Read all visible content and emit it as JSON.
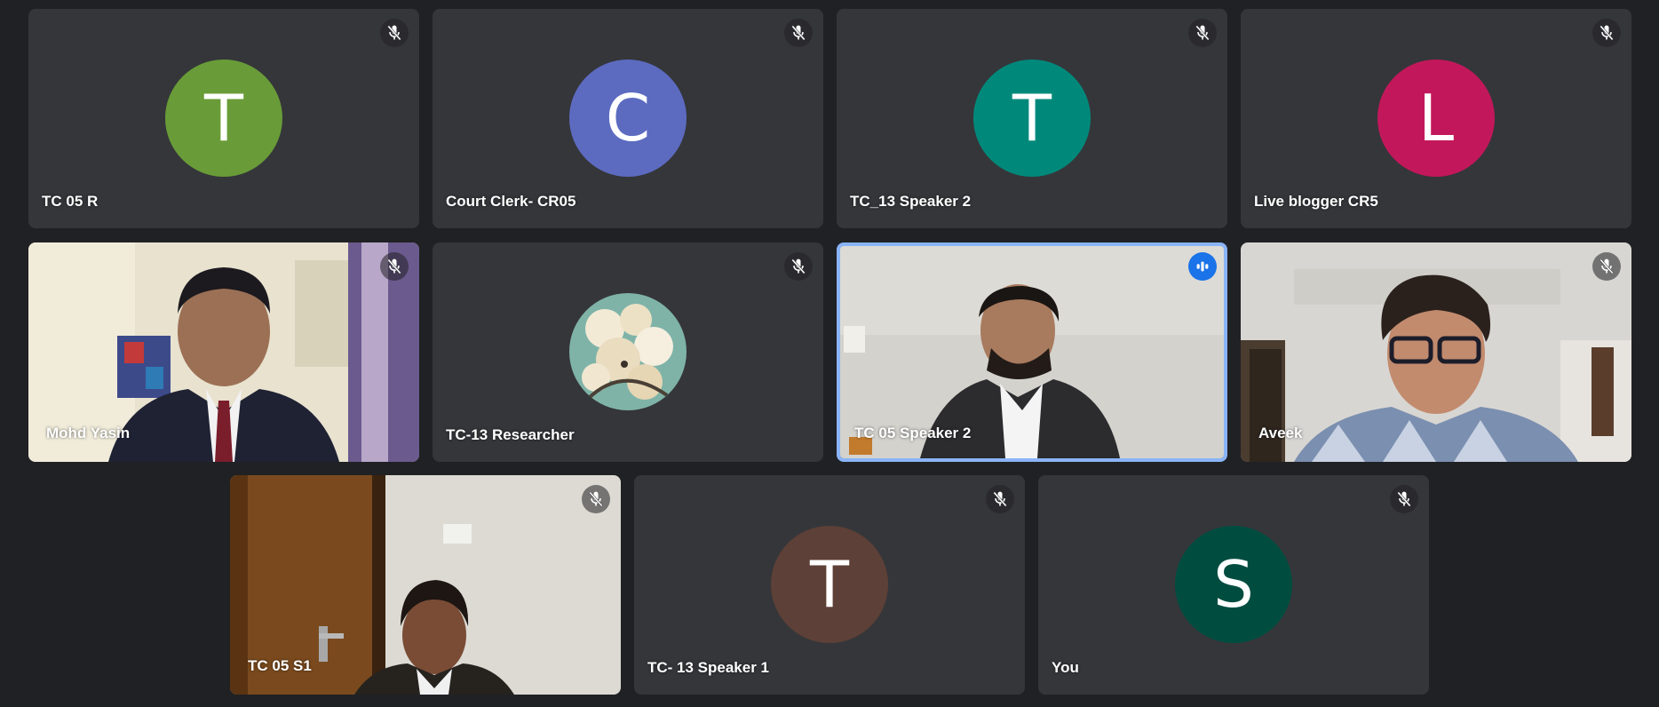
{
  "participants": [
    {
      "name": "TC 05 R",
      "initial": "T",
      "color": "#699c38",
      "mic": "muted"
    },
    {
      "name": "Court Clerk- CR05",
      "initial": "C",
      "color": "#5c6bc0",
      "mic": "muted"
    },
    {
      "name": "TC_13 Speaker 2",
      "initial": "T",
      "color": "#00897b",
      "mic": "muted"
    },
    {
      "name": "Live blogger CR5",
      "initial": "L",
      "color": "#c2185b",
      "mic": "muted"
    },
    {
      "name": "Mohd Yasin",
      "mic": "muted",
      "video": "camera-on"
    },
    {
      "name": "TC-13 Researcher",
      "mic": "muted",
      "avatar": "profile-photo"
    },
    {
      "name": "TC 05 Speaker 2",
      "mic": "speaking",
      "video": "camera-on",
      "active": true
    },
    {
      "name": "Aveek",
      "mic": "muted",
      "video": "camera-on"
    },
    {
      "name": "TC 05 S1",
      "mic": "muted",
      "video": "camera-on"
    },
    {
      "name": "TC- 13 Speaker 1",
      "initial": "T",
      "color": "#5d4037",
      "mic": "muted"
    },
    {
      "name": "You",
      "initial": "S",
      "color": "#004d40",
      "mic": "muted"
    }
  ]
}
